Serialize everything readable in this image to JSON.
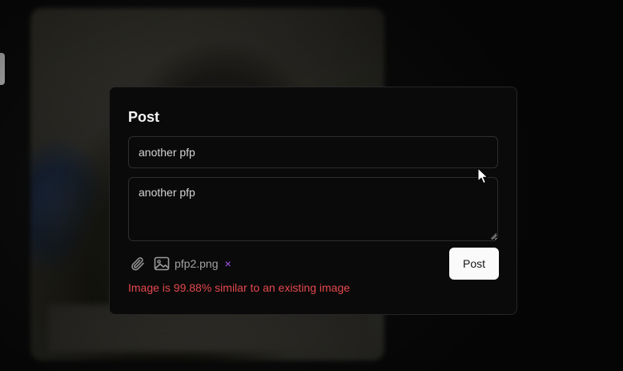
{
  "dialog": {
    "title": "Post",
    "title_value": "another pfp",
    "body_value": "another pfp",
    "attachment": {
      "file_name": "pfp2.png",
      "remove_glyph": "×"
    },
    "post_button_label": "Post",
    "error_message": "Image is 99.88% similar to an existing image"
  },
  "icons": {
    "attach": "paperclip-icon",
    "image": "image-icon",
    "remove": "close-icon"
  },
  "colors": {
    "background": "#0a0a0a",
    "border": "#262626",
    "error": "#e5484d",
    "remove_accent": "#a855f7",
    "button_bg": "#fafafa"
  }
}
